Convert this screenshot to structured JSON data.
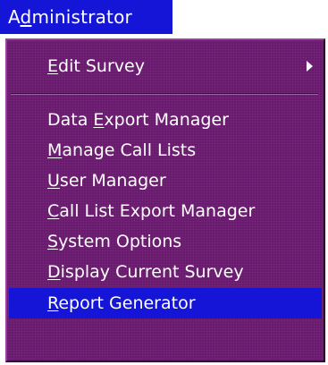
{
  "menubar": {
    "title_before": "A",
    "title_mnemonic": "d",
    "title_after": "ministrator"
  },
  "menu": {
    "edit_survey": {
      "mnemonic": "E",
      "rest": "dit Survey",
      "has_submenu": true
    },
    "data_export_manager": {
      "before": "Data ",
      "mnemonic": "E",
      "rest": "xport Manager"
    },
    "manage_call_lists": {
      "mnemonic": "M",
      "rest": "anage Call Lists"
    },
    "user_manager": {
      "mnemonic": "U",
      "rest": "ser Manager"
    },
    "call_list_export_manager": {
      "mnemonic": "C",
      "rest": "all List Export Manager"
    },
    "system_options": {
      "mnemonic": "S",
      "rest": "ystem Options"
    },
    "display_current_survey": {
      "mnemonic": "D",
      "rest": "isplay Current Survey"
    },
    "report_generator": {
      "mnemonic": "R",
      "rest": "eport Generator",
      "selected": true
    }
  },
  "colors": {
    "menu_background": "#6a1a6e",
    "highlight": "#1515d8",
    "text": "#ffffff"
  },
  "icons": {
    "submenu_arrow": "triangle-right"
  }
}
